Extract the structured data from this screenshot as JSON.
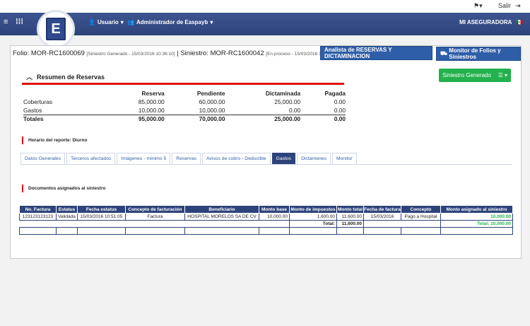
{
  "topbar": {
    "logout_label": "Salir"
  },
  "navbar": {
    "user_label": "Usuario",
    "admin_label": "Administrador de Easpayb",
    "company": "MI ASEGURADORA"
  },
  "folio": {
    "prefix": "Folio: MOR-RC1600069",
    "status": "[Siniestro Generado - 15/03/2016 10:36:10]",
    "siniestro": "| Siniestro: MOR-RC1600042",
    "siniestro_status": "[En proceso - 15/03/2016 10:3"
  },
  "buttons": {
    "analista": "Analista de RESERVAS Y DICTAMINACION",
    "monitor": "Monitor de Folios y Siniestros",
    "siniestro_generado": "Siniestro Generado"
  },
  "resumen": {
    "title": "Resumen de Reservas",
    "headers": [
      "",
      "Reserva",
      "Pendiente",
      "Dictaminada",
      "Pagada"
    ],
    "rows": [
      [
        "Coberturas",
        "85,000.00",
        "60,000.00",
        "25,000.00",
        "0.00"
      ],
      [
        "Gastos",
        "10,000.00",
        "10,000.00",
        "0.00",
        "0.00"
      ]
    ],
    "total": [
      "Totales",
      "95,000.00",
      "70,000.00",
      "25,000.00",
      "0.00"
    ]
  },
  "horario": "Horario del reporte: Diurno",
  "tabs": [
    "Datos Generales",
    "Terceros afectados",
    "Imágenes - mínimo 5",
    "Reservas",
    "Avisos de cobro - Deducible",
    "Gastos",
    "Dictámenes",
    "Monitor"
  ],
  "active_tab": "Gastos",
  "documentos_title": "Documentos asignados al siniestro",
  "gastos_table": {
    "headers": [
      "No. Factura",
      "Estatus",
      "Fecha estatus",
      "Concepto de facturación",
      "Beneficiario",
      "Monto base",
      "Monto de impuestos",
      "Monto total",
      "Fecha de factura",
      "Concepto",
      "Monto asignado al siniestro"
    ],
    "row": [
      "123123123123",
      "Validada",
      "15/03/2016 10:51:05",
      "Factura",
      "HOSPITAL MORELOS SA DE CV",
      "10,000.00",
      "1,600.00",
      "11,600.00",
      "15/03/2016",
      "Pago a Hospital",
      "10,000.00"
    ],
    "total_label": "Total:",
    "total_value": "11,600.00",
    "total_assigned": "Total: 10,000.00"
  },
  "colors": {
    "navbar": "#2d437b",
    "accent_red": "#e01010",
    "accent_green": "#22b14c",
    "button_blue": "#2f5ea8"
  }
}
